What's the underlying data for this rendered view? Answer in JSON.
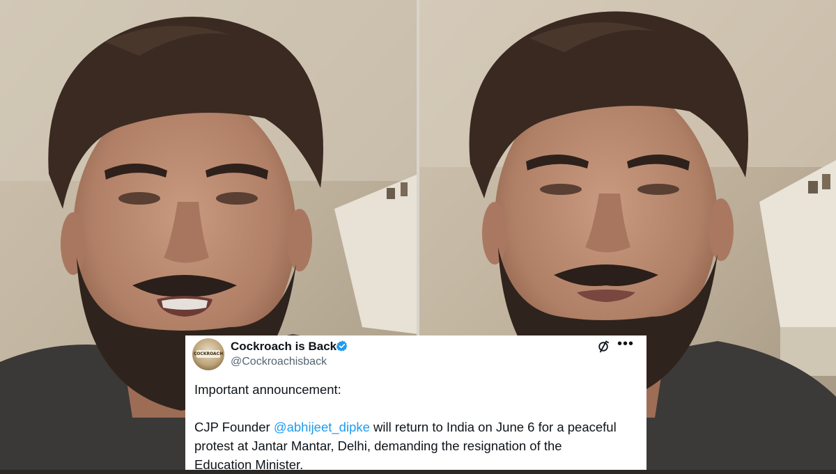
{
  "tweet": {
    "display_name": "Cockroach is Back",
    "handle": "@Cockroachisback",
    "avatar_text": "COCKROACH",
    "line1": "Important announcement:",
    "body_prefix": "CJP Founder ",
    "mention": "@abhijeet_dipke",
    "body_rest_1": " will return to India on June 6 for a peaceful",
    "body_line_2": "protest at Jantar Mantar, Delhi, demanding the resignation of the",
    "body_line_3": "Education Minister."
  },
  "icons": {
    "verified": "verified-badge-icon",
    "sync": "sync-icon",
    "more": "more-options-icon"
  },
  "colors": {
    "accent": "#1d9bf0",
    "text": "#0f1419",
    "muted": "#536471"
  }
}
